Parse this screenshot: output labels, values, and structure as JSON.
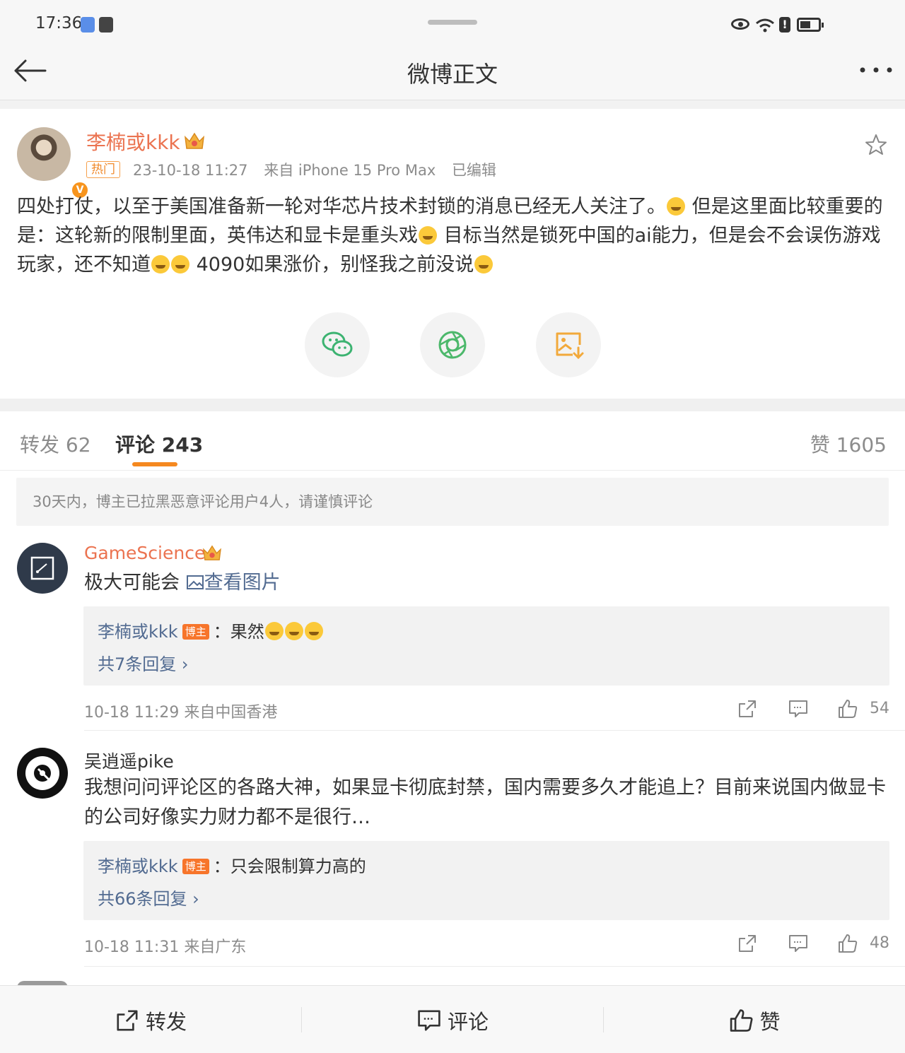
{
  "status_bar": {
    "time": "17:36"
  },
  "header": {
    "title": "微博正文"
  },
  "post": {
    "author": "李楠或kkk",
    "hot_label": "热门",
    "vip_badge": "V",
    "time": "23-10-18 11:27",
    "source": "来自 iPhone 15 Pro Max",
    "edited": "已编辑",
    "text_segments": [
      "四处打仗，以至于美国准备新一轮对华芯片技术封锁的消息已经无人关注了。",
      " 但是这里面比较重要的是：这轮新的限制里面，英伟达和显卡是重头戏",
      " 目标当然是锁死中国的ai能力，但是会不会误伤游戏玩家，还不知道",
      " 4090如果涨价，别怪我之前没说"
    ],
    "share_icons": [
      "wechat-icon",
      "moments-icon",
      "save-image-icon"
    ]
  },
  "tabs": {
    "repost": "转发 62",
    "comment": "评论 243",
    "like": "赞 1605"
  },
  "notice": "30天内，博主已拉黑恶意评论用户4人，请谨慎评论",
  "comments": [
    {
      "name": "GameScience",
      "name_color": "#eb7350",
      "text": "极大可能会",
      "link": "查看图片",
      "reply": {
        "author": "李楠或kkk",
        "badge": "博主",
        "text": "：果然"
      },
      "reply_more": "共7条回复 ›",
      "footer": "10-18 11:29  来自中国香港",
      "likes": "54"
    },
    {
      "name": "吴逍遥pike",
      "name_color": "#333333",
      "text": "我想问问评论区的各路大神，如果显卡彻底封禁，国内需要多久才能追上？目前来说国内做显卡的公司好像实力财力都不是很行…",
      "reply": {
        "author": "李楠或kkk",
        "badge": "博主",
        "text": "：只会限制算力高的"
      },
      "reply_more": "共66条回复 ›",
      "footer": "10-18 11:31  来自广东",
      "likes": "48"
    }
  ],
  "bottom_bar": {
    "repost": "转发",
    "comment": "评论",
    "like": "赞"
  },
  "colors": {
    "accent": "#f5881f",
    "username": "#eb7350",
    "link": "#526b91",
    "badge": "#f7752b"
  }
}
